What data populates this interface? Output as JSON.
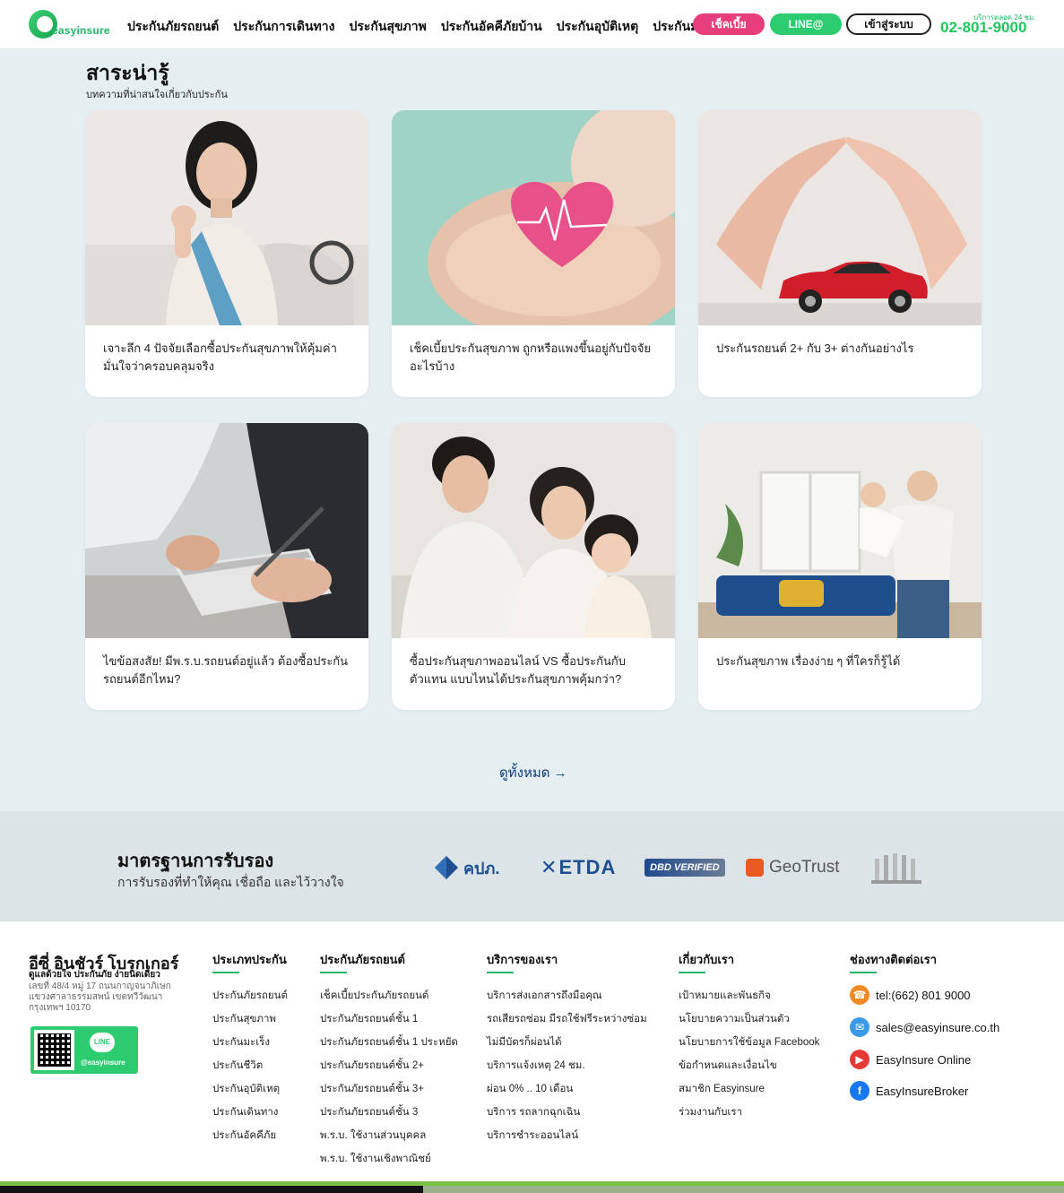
{
  "header": {
    "logo_text": "easyinsure",
    "nav": [
      "ประกันภัยรถยนต์",
      "ประกันการเดินทาง",
      "ประกันสุขภาพ",
      "ประกันอัคคีภัยบ้าน",
      "ประกันอุบัติเหตุ",
      "ประกันมะเร็ง"
    ],
    "check_price_label": "เช็คเบี้ย",
    "line_label": "LINE@",
    "login_label": "เข้าสู่ระบบ",
    "hotline_label": "บริการตลอด 24 ชม.",
    "hotline_number": "02-801-9000"
  },
  "articles": {
    "title": "สาระน่ารู้",
    "subtitle": "บทความที่น่าสนใจเกี่ยวกับประกัน",
    "items": [
      "เจาะลึก 4 ปัจจัยเลือกซื้อประกันสุขภาพให้คุ้มค่า มั่นใจว่าครอบคลุมจริง",
      "เช็คเบี้ยประกันสุขภาพ ถูกหรือแพงขึ้นอยู่กับปัจจัยอะไรบ้าง",
      "ประกันรถยนต์ 2+ กับ 3+ ต่างกันอย่างไร",
      "ไขข้อสงสัย! มีพ.ร.บ.รถยนต์อยู่แล้ว ต้องซื้อประกันรถยนต์อีกไหม?",
      "ซื้อประกันสุขภาพออนไลน์ VS ซื้อประกันกับตัวแทน แบบไหนได้ประกันสุขภาพคุ้มกว่า?",
      "ประกันสุขภาพ เรื่องง่าย ๆ ที่ใครก็รู้ได้"
    ],
    "view_all": "ดูทั้งหมด →"
  },
  "certification": {
    "title": "มาตรฐานการรับรอง",
    "subtitle": "การรับรองที่ทำให้คุณ เชื่อถือ และไว้วางใจ",
    "logos": [
      "คปภ.",
      "ETDA",
      "DBD VERIFIED",
      "GeoTrust"
    ]
  },
  "footer": {
    "brand": "อีซี่ อินชัวร์ โบรกเกอร์",
    "tagline": "ดูแลด้วยใจ ประกันภัย ง่ายนิดเดียว",
    "address": "เลขที่ 48/4 หมู่ 17 ถนนกาญจนาภิเษก แขวงศาลาธรรมสพน์ เขตทวีวัฒนา กรุงเทพฯ 10170",
    "line_id": "@easyinsure",
    "line_badge": "LINE",
    "columns": [
      {
        "title": "ประเภทประกัน",
        "links": [
          "ประกันภัยรถยนต์",
          "ประกันสุขภาพ",
          "ประกันมะเร็ง",
          "ประกันชีวิต",
          "ประกันอุบัติเหตุ",
          "ประกันเดินทาง",
          "ประกันอัคคีภัย"
        ]
      },
      {
        "title": "ประกันภัยรถยนต์",
        "links": [
          "เช็คเบี้ยประกันภัยรถยนต์",
          "ประกันภัยรถยนต์ชั้น 1",
          "ประกันภัยรถยนต์ชั้น 1 ประหยัด",
          "ประกันภัยรถยนต์ชั้น 2+",
          "ประกันภัยรถยนต์ชั้น 3+",
          "ประกันภัยรถยนต์ชั้น 3",
          "พ.ร.บ. ใช้งานส่วนบุคคล",
          "พ.ร.บ. ใช้งานเชิงพาณิชย์"
        ]
      },
      {
        "title": "บริการของเรา",
        "links": [
          "บริการส่งเอกสารถึงมือคุณ",
          "รถเสียรถซ่อม มีรถใช้ฟรีระหว่างซ่อม",
          "ไม่มีบัตรก็ผ่อนได้",
          "บริการแจ้งเหตุ 24 ชม.",
          "ผ่อน 0% .. 10 เดือน",
          "บริการ รถลากฉุกเฉิน",
          "บริการชำระออนไลน์"
        ]
      },
      {
        "title": "เกี่ยวกับเรา",
        "links": [
          "เป้าหมายและพันธกิจ",
          "นโยบายความเป็นส่วนตัว",
          "นโยบายการใช้ข้อมูล Facebook",
          "ข้อกำหนดและเงื่อนไข",
          "สมาชิก Easyinsure",
          "ร่วมงานกับเรา"
        ]
      }
    ],
    "contact": {
      "title": "ช่องทางติดต่อเรา",
      "items": [
        "tel:(662) 801 9000",
        "sales@easyinsure.co.th",
        "EasyInsure Online",
        "EasyInsureBroker"
      ]
    }
  },
  "colors": {
    "brand_green": "#22c55e",
    "pink": "#e83e7c",
    "navy_link": "#0b3b7a"
  }
}
